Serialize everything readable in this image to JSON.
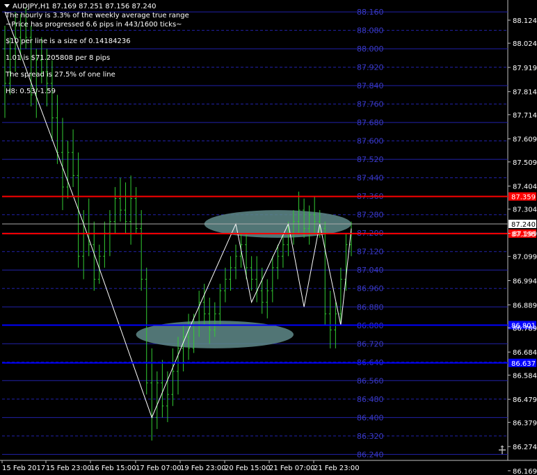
{
  "header": {
    "symbol_line": "AUDJPY,H1  87.169 87.251 87.156 87.240",
    "info_lines": [
      "The hourly is 3.3% of the weekly average true range",
      "~Price has progressed  6.6  pips in 443/1600 ticks~",
      "$10 per line is a size of 0.14184236",
      "1.01 is $71.205808 per 8 pips",
      "The spread is 27.5% of one line",
      "H8: 0.53/-1.59"
    ]
  },
  "colors": {
    "background": "#000000",
    "candle": "#33cc33",
    "grid_line": "#2222aa",
    "level_label": "#3a3ac8",
    "resistance": "#ff0000",
    "support": "#0000ff",
    "zigzag": "#ffffff",
    "ellipse": "#5f8a8a",
    "axis_text": "#ffffff"
  },
  "price_axis": {
    "ticks": [
      "88.124",
      "88.024",
      "87.919",
      "87.814",
      "87.714",
      "87.609",
      "87.509",
      "87.404",
      "87.304",
      "87.199",
      "87.099",
      "86.994",
      "86.889",
      "86.789",
      "86.684",
      "86.584",
      "86.479",
      "86.379",
      "86.274",
      "86.169"
    ]
  },
  "time_axis": {
    "labels": [
      "15 Feb 2017",
      "15 Feb 23:00",
      "16 Feb 15:00",
      "17 Feb 07:00",
      "19 Feb 23:00",
      "20 Feb 15:00",
      "21 Feb 07:00",
      "21 Feb 23:00"
    ]
  },
  "grid_levels": [
    "88.160",
    "88.080",
    "88.000",
    "87.920",
    "87.840",
    "87.760",
    "87.680",
    "87.600",
    "87.520",
    "87.440",
    "87.360",
    "87.280",
    "87.200",
    "87.120",
    "87.040",
    "86.960",
    "86.880",
    "86.800",
    "86.720",
    "86.640",
    "86.560",
    "86.480",
    "86.400",
    "86.320",
    "86.240",
    "86.160"
  ],
  "current_price": {
    "value": "87.240"
  },
  "horizontal_lines": [
    {
      "name": "resistance-upper",
      "value": "87.359",
      "color": "#ff0000"
    },
    {
      "name": "resistance-lower",
      "value": "87.198",
      "color": "#ff0000"
    },
    {
      "name": "support-upper",
      "value": "86.801",
      "color": "#0000ff"
    },
    {
      "name": "support-lower",
      "value": "86.637",
      "color": "#0000ff"
    }
  ],
  "chart_data": {
    "type": "ohlc",
    "symbol": "AUDJPY",
    "timeframe": "H1",
    "ylim": [
      86.16,
      88.18
    ],
    "bars": [
      [
        88.0,
        88.1,
        87.7,
        87.85
      ],
      [
        87.85,
        88.05,
        87.8,
        88.0
      ],
      [
        88.0,
        88.16,
        87.9,
        88.05
      ],
      [
        88.05,
        88.15,
        87.95,
        88.1
      ],
      [
        88.1,
        88.18,
        88.0,
        88.05
      ],
      [
        88.05,
        88.1,
        87.75,
        87.8
      ],
      [
        87.8,
        88.0,
        87.7,
        87.95
      ],
      [
        87.95,
        88.05,
        87.85,
        87.9
      ],
      [
        87.9,
        88.0,
        87.75,
        87.85
      ],
      [
        87.85,
        87.95,
        87.6,
        87.7
      ],
      [
        87.7,
        87.8,
        87.5,
        87.55
      ],
      [
        87.55,
        87.7,
        87.3,
        87.4
      ],
      [
        87.4,
        87.6,
        87.35,
        87.55
      ],
      [
        87.55,
        87.65,
        87.4,
        87.45
      ],
      [
        87.45,
        87.55,
        87.05,
        87.1
      ],
      [
        87.1,
        87.3,
        87.0,
        87.2
      ],
      [
        87.2,
        87.35,
        87.1,
        87.15
      ],
      [
        87.15,
        87.25,
        86.95,
        87.0
      ],
      [
        87.0,
        87.15,
        86.98,
        87.1
      ],
      [
        87.1,
        87.25,
        87.05,
        87.2
      ],
      [
        87.2,
        87.3,
        87.1,
        87.25
      ],
      [
        87.25,
        87.4,
        87.2,
        87.35
      ],
      [
        87.35,
        87.44,
        87.25,
        87.3
      ],
      [
        87.3,
        87.42,
        87.2,
        87.25
      ],
      [
        87.25,
        87.45,
        87.15,
        87.35
      ],
      [
        87.35,
        87.4,
        87.2,
        87.22
      ],
      [
        87.22,
        87.3,
        86.95,
        87.0
      ],
      [
        87.0,
        87.05,
        86.5,
        86.55
      ],
      [
        86.55,
        86.7,
        86.3,
        86.4
      ],
      [
        86.4,
        86.6,
        86.35,
        86.55
      ],
      [
        86.55,
        86.65,
        86.4,
        86.45
      ],
      [
        86.45,
        86.6,
        86.38,
        86.5
      ],
      [
        86.5,
        86.7,
        86.45,
        86.6
      ],
      [
        86.6,
        86.75,
        86.5,
        86.7
      ],
      [
        86.7,
        86.8,
        86.6,
        86.75
      ],
      [
        86.75,
        86.85,
        86.65,
        86.7
      ],
      [
        86.7,
        86.85,
        86.68,
        86.8
      ],
      [
        86.8,
        86.95,
        86.75,
        86.9
      ],
      [
        86.9,
        86.98,
        86.8,
        86.85
      ],
      [
        86.85,
        86.92,
        86.72,
        86.78
      ],
      [
        86.78,
        86.9,
        86.75,
        86.85
      ],
      [
        86.85,
        86.98,
        86.8,
        86.95
      ],
      [
        86.95,
        87.05,
        86.9,
        87.0
      ],
      [
        87.0,
        87.1,
        86.95,
        87.05
      ],
      [
        87.05,
        87.15,
        87.0,
        87.1
      ],
      [
        87.1,
        87.2,
        87.05,
        87.15
      ],
      [
        87.15,
        87.2,
        87.0,
        87.05
      ],
      [
        87.05,
        87.1,
        86.95,
        87.0
      ],
      [
        87.0,
        87.1,
        86.9,
        86.95
      ],
      [
        86.95,
        87.05,
        86.85,
        86.9
      ],
      [
        86.9,
        87.0,
        86.83,
        86.95
      ],
      [
        86.95,
        87.1,
        86.9,
        87.05
      ],
      [
        87.05,
        87.15,
        87.0,
        87.1
      ],
      [
        87.1,
        87.2,
        87.05,
        87.15
      ],
      [
        87.15,
        87.25,
        87.1,
        87.2
      ],
      [
        87.2,
        87.3,
        87.15,
        87.25
      ],
      [
        87.25,
        87.38,
        87.2,
        87.3
      ],
      [
        87.3,
        87.35,
        87.18,
        87.22
      ],
      [
        87.22,
        87.32,
        87.15,
        87.28
      ],
      [
        87.28,
        87.36,
        87.2,
        87.25
      ],
      [
        87.25,
        87.3,
        87.18,
        87.22
      ],
      [
        87.22,
        87.25,
        86.8,
        86.85
      ],
      [
        86.85,
        86.95,
        86.7,
        86.78
      ],
      [
        86.78,
        86.9,
        86.7,
        86.85
      ],
      [
        86.85,
        87.05,
        86.8,
        87.0
      ],
      [
        87.0,
        87.2,
        86.95,
        87.15
      ],
      [
        87.15,
        87.25,
        87.1,
        87.24
      ]
    ],
    "zigzag": [
      [
        0,
        88.16
      ],
      [
        15,
        87.24
      ],
      [
        28,
        86.4
      ],
      [
        35,
        86.78
      ],
      [
        44,
        87.24
      ],
      [
        47,
        86.9
      ],
      [
        54,
        87.24
      ],
      [
        57,
        86.88
      ],
      [
        60,
        87.24
      ],
      [
        64,
        86.8
      ],
      [
        66,
        87.22
      ]
    ],
    "ellipses": [
      {
        "label": "resistance-zone",
        "center_bar": 52,
        "price_center": 87.24,
        "bar_half_width": 14,
        "price_half_height": 0.06
      },
      {
        "label": "support-zone",
        "center_bar": 40,
        "price_center": 86.76,
        "bar_half_width": 15,
        "price_half_height": 0.06
      }
    ]
  }
}
